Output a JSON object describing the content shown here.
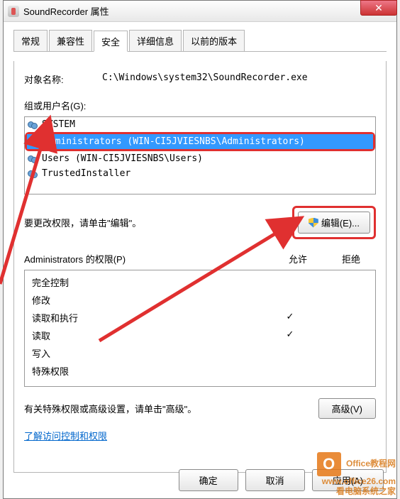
{
  "titlebar": {
    "title": "SoundRecorder 属性"
  },
  "tabs": {
    "general": "常规",
    "compat": "兼容性",
    "security": "安全",
    "details": "详细信息",
    "prev": "以前的版本"
  },
  "object": {
    "label": "对象名称:",
    "path": "C:\\Windows\\system32\\SoundRecorder.exe"
  },
  "groups": {
    "label": "组或用户名(G):",
    "items": [
      {
        "name": "SYSTEM",
        "selected": false
      },
      {
        "name": "Administrators (WIN-CI5JVIESNBS\\Administrators)",
        "selected": true
      },
      {
        "name": "Users (WIN-CI5JVIESNBS\\Users)",
        "selected": false
      },
      {
        "name": "TrustedInstaller",
        "selected": false
      }
    ]
  },
  "edit": {
    "hint": "要更改权限，请单击\"编辑\"。",
    "button": "编辑(E)..."
  },
  "perm_header": {
    "title": "Administrators 的权限(P)",
    "allow": "允许",
    "deny": "拒绝"
  },
  "permissions": [
    {
      "name": "完全控制",
      "allow": "",
      "deny": ""
    },
    {
      "name": "修改",
      "allow": "",
      "deny": ""
    },
    {
      "name": "读取和执行",
      "allow": "✓",
      "deny": ""
    },
    {
      "name": "读取",
      "allow": "✓",
      "deny": ""
    },
    {
      "name": "写入",
      "allow": "",
      "deny": ""
    },
    {
      "name": "特殊权限",
      "allow": "",
      "deny": ""
    }
  ],
  "advanced": {
    "hint": "有关特殊权限或高级设置，请单击\"高级\"。",
    "button": "高级(V)"
  },
  "link": "了解访问控制和权限",
  "buttons": {
    "ok": "确定",
    "cancel": "取消",
    "apply": "应用(A)"
  },
  "watermark": {
    "brand": "Office教程网",
    "site1": "www.office26.com",
    "site2": "看电脑系统之家"
  }
}
